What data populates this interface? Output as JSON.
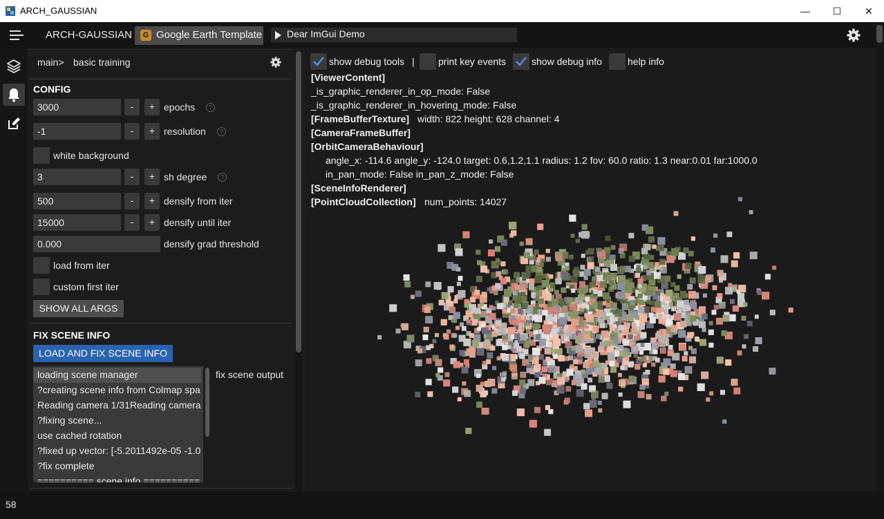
{
  "window": {
    "title": "ARCH_GAUSSIAN",
    "minimize_glyph": "—",
    "maximize_glyph": "☐",
    "close_glyph": "✕"
  },
  "menubar": {
    "app_name": "ARCH-GAUSSIAN",
    "tab_active_icon_letter": "G",
    "tab_active": "Google Earth Template",
    "tab_demo": "Dear ImGui Demo"
  },
  "icons": {
    "menu": "hamburger-icon",
    "settings": "gear-icon",
    "layers": "layers-icon",
    "bell": "bell-icon",
    "edit": "edit-icon"
  },
  "breadcrumb": {
    "root": "main>",
    "page": "basic training"
  },
  "config": {
    "title": "CONFIG",
    "epochs": {
      "value": "3000",
      "label": "epochs"
    },
    "resolution": {
      "value": "-1",
      "label": "resolution"
    },
    "white_background": {
      "label": "white background",
      "checked": false
    },
    "sh_degree": {
      "value": "3",
      "label": "sh degree"
    },
    "densify_from_iter": {
      "value": "500",
      "label": "densify from iter"
    },
    "densify_until_iter": {
      "value": "15000",
      "label": "densify until iter"
    },
    "densify_grad_threshold": {
      "value": "0.000",
      "label": "densify grad threshold"
    },
    "load_from_iter": {
      "label": "load from iter",
      "checked": false
    },
    "custom_first_iter": {
      "label": "custom first iter",
      "checked": false
    },
    "show_all_args": "SHOW ALL ARGS",
    "minus": "-",
    "plus": "+",
    "help": "?"
  },
  "fix_scene": {
    "title": "FIX SCENE INFO",
    "button": "LOAD AND FIX SCENE INFO",
    "output_label": "fix scene output",
    "log": [
      "loading scene manager",
      "?creating scene info from Colmap spa",
      "Reading camera 1/31Reading camera",
      "?fixing scene...",
      "use cached rotation",
      "?fixed up vector: [-5.2011492e-05 -1.0",
      "?fix complete",
      "========== scene info =========="
    ]
  },
  "debug": {
    "show_debug_tools": {
      "label": "show debug tools",
      "checked": true
    },
    "separator": "|",
    "print_key_events": {
      "label": "print key events",
      "checked": false
    },
    "show_debug_info": {
      "label": "show debug info",
      "checked": true
    },
    "help_info": {
      "label": "help info",
      "checked": false
    },
    "lines": {
      "viewer_content": "[ViewerContent]",
      "op_mode": "_is_graphic_renderer_in_op_mode: False",
      "hovering_mode": "_is_graphic_renderer_in_hovering_mode: False",
      "fbt_tag": "[FrameBufferTexture]",
      "fbt_info": "width: 822 height: 628 channel: 4",
      "camera_fb": "[CameraFrameBuffer]",
      "orbit": "[OrbitCameraBehaviour]",
      "orbit_info": "angle_x: -114.6 angle_y: -124.0 target: 0.6,1.2,1.1 radius: 1.2 fov: 60.0 ratio: 1.3 near:0.01 far:1000.0",
      "pan_info": "in_pan_mode: False in_pan_z_mode: False",
      "scene_info_renderer": "[SceneInfoRenderer]",
      "pcc_tag": "[PointCloudCollection]",
      "pcc_info": "num_points: 14027"
    }
  },
  "status": {
    "fps": "58"
  },
  "colors": {
    "accent_blue": "#2a63b0",
    "checkbox_check": "#4a8fe0",
    "tab_icon": "#c98a2e"
  }
}
